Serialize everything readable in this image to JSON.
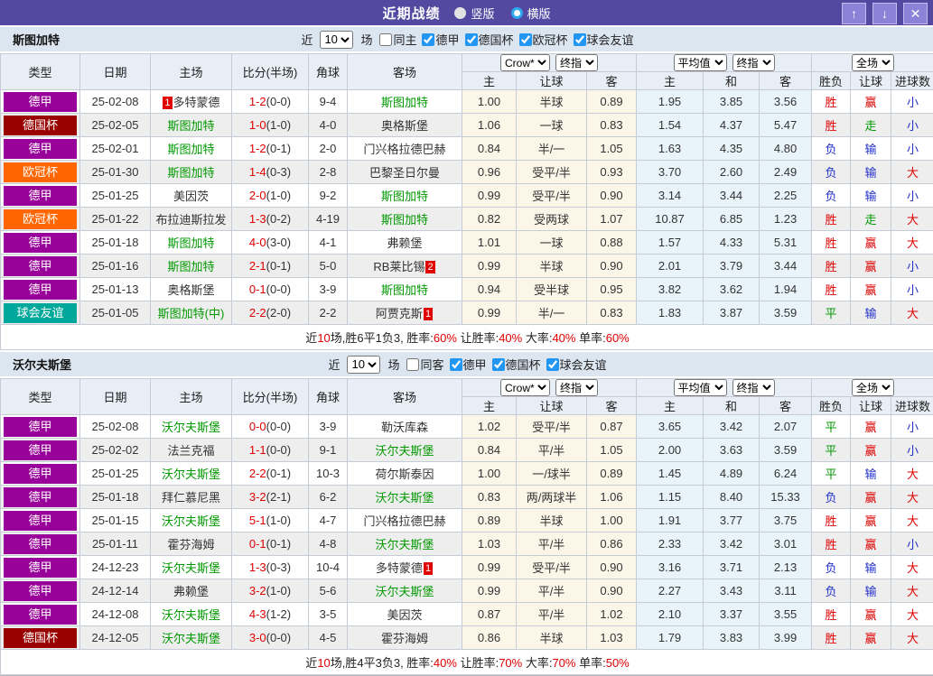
{
  "titlebar": {
    "title": "近期战绩",
    "radio_vertical": "竖版",
    "radio_horizontal": "横版",
    "btn_up": "↑",
    "btn_down": "↓",
    "btn_close": "✕"
  },
  "table": {
    "main_columns": [
      "类型",
      "日期",
      "主场",
      "比分(半场)",
      "角球",
      "客场"
    ],
    "sub_columns": [
      "主",
      "让球",
      "客",
      "主",
      "和",
      "客",
      "胜负",
      "让球",
      "进球数"
    ],
    "selects": {
      "bookmaker": "Crow*",
      "crow_stage": "终指",
      "average": "平均值",
      "avg_stage": "终指",
      "scope": "全场"
    }
  },
  "league_colors": {
    "德甲": "#990099",
    "德国杯": "#990000",
    "欧冠杯": "#ff6600",
    "球会友谊": "#00a79b"
  },
  "result_colors": {
    "r": "#e00000",
    "b": "#2330cc",
    "g": "#009900"
  },
  "sections": [
    {
      "team": "斯图加特",
      "filter": {
        "near": "近",
        "count": "10",
        "games": "场",
        "same": "同主",
        "leagues": [
          "德甲",
          "德国杯",
          "欧冠杯",
          "球会友谊"
        ]
      },
      "rows": [
        {
          "lg": "德甲",
          "dt": "25-02-08",
          "hm": {
            "n": "多特蒙德",
            "g": 0,
            "rk": "1",
            "rp": "b"
          },
          "sc": "1-2",
          "hf": "(0-0)",
          "ck": "9-4",
          "aw": {
            "n": "斯图加特",
            "g": 1
          },
          "od": [
            "1.00",
            "半球",
            "0.89"
          ],
          "av": [
            "1.95",
            "3.85",
            "3.56"
          ],
          "rs": [
            [
              "胜",
              "r"
            ],
            [
              "赢",
              "r"
            ],
            [
              "小",
              "b"
            ]
          ]
        },
        {
          "lg": "德国杯",
          "dt": "25-02-05",
          "hm": {
            "n": "斯图加特",
            "g": 1
          },
          "sc": "1-0",
          "hf": "(1-0)",
          "ck": "4-0",
          "aw": {
            "n": "奥格斯堡",
            "g": 0
          },
          "od": [
            "1.06",
            "一球",
            "0.83"
          ],
          "av": [
            "1.54",
            "4.37",
            "5.47"
          ],
          "rs": [
            [
              "胜",
              "r"
            ],
            [
              "走",
              "g"
            ],
            [
              "小",
              "b"
            ]
          ]
        },
        {
          "lg": "德甲",
          "dt": "25-02-01",
          "hm": {
            "n": "斯图加特",
            "g": 1
          },
          "sc": "1-2",
          "hf": "(0-1)",
          "ck": "2-0",
          "aw": {
            "n": "门兴格拉德巴赫",
            "g": 0
          },
          "od": [
            "0.84",
            "半/一",
            "1.05"
          ],
          "av": [
            "1.63",
            "4.35",
            "4.80"
          ],
          "rs": [
            [
              "负",
              "b"
            ],
            [
              "输",
              "b"
            ],
            [
              "小",
              "b"
            ]
          ]
        },
        {
          "lg": "欧冠杯",
          "dt": "25-01-30",
          "hm": {
            "n": "斯图加特",
            "g": 1
          },
          "sc": "1-4",
          "hf": "(0-3)",
          "ck": "2-8",
          "aw": {
            "n": "巴黎圣日尔曼",
            "g": 0
          },
          "od": [
            "0.96",
            "受平/半",
            "0.93"
          ],
          "av": [
            "3.70",
            "2.60",
            "2.49"
          ],
          "rs": [
            [
              "负",
              "b"
            ],
            [
              "输",
              "b"
            ],
            [
              "大",
              "r"
            ]
          ]
        },
        {
          "lg": "德甲",
          "dt": "25-01-25",
          "hm": {
            "n": "美因茨",
            "g": 0
          },
          "sc": "2-0",
          "hf": "(1-0)",
          "ck": "9-2",
          "aw": {
            "n": "斯图加特",
            "g": 1
          },
          "od": [
            "0.99",
            "受平/半",
            "0.90"
          ],
          "av": [
            "3.14",
            "3.44",
            "2.25"
          ],
          "rs": [
            [
              "负",
              "b"
            ],
            [
              "输",
              "b"
            ],
            [
              "小",
              "b"
            ]
          ]
        },
        {
          "lg": "欧冠杯",
          "dt": "25-01-22",
          "hm": {
            "n": "布拉迪斯拉发",
            "g": 0
          },
          "sc": "1-3",
          "hf": "(0-2)",
          "ck": "4-19",
          "aw": {
            "n": "斯图加特",
            "g": 1
          },
          "od": [
            "0.82",
            "受两球",
            "1.07"
          ],
          "av": [
            "10.87",
            "6.85",
            "1.23"
          ],
          "rs": [
            [
              "胜",
              "r"
            ],
            [
              "走",
              "g"
            ],
            [
              "大",
              "r"
            ]
          ]
        },
        {
          "lg": "德甲",
          "dt": "25-01-18",
          "hm": {
            "n": "斯图加特",
            "g": 1
          },
          "sc": "4-0",
          "hf": "(3-0)",
          "ck": "4-1",
          "aw": {
            "n": "弗赖堡",
            "g": 0
          },
          "od": [
            "1.01",
            "一球",
            "0.88"
          ],
          "av": [
            "1.57",
            "4.33",
            "5.31"
          ],
          "rs": [
            [
              "胜",
              "r"
            ],
            [
              "赢",
              "r"
            ],
            [
              "大",
              "r"
            ]
          ]
        },
        {
          "lg": "德甲",
          "dt": "25-01-16",
          "hm": {
            "n": "斯图加特",
            "g": 1
          },
          "sc": "2-1",
          "hf": "(0-1)",
          "ck": "5-0",
          "aw": {
            "n": "RB莱比锡",
            "g": 0,
            "rk": "2",
            "rp": "a"
          },
          "od": [
            "0.99",
            "半球",
            "0.90"
          ],
          "av": [
            "2.01",
            "3.79",
            "3.44"
          ],
          "rs": [
            [
              "胜",
              "r"
            ],
            [
              "赢",
              "r"
            ],
            [
              "小",
              "b"
            ]
          ]
        },
        {
          "lg": "德甲",
          "dt": "25-01-13",
          "hm": {
            "n": "奥格斯堡",
            "g": 0
          },
          "sc": "0-1",
          "hf": "(0-0)",
          "ck": "3-9",
          "aw": {
            "n": "斯图加特",
            "g": 1
          },
          "od": [
            "0.94",
            "受半球",
            "0.95"
          ],
          "av": [
            "3.82",
            "3.62",
            "1.94"
          ],
          "rs": [
            [
              "胜",
              "r"
            ],
            [
              "赢",
              "r"
            ],
            [
              "小",
              "b"
            ]
          ]
        },
        {
          "lg": "球会友谊",
          "dt": "25-01-05",
          "hm": {
            "n": "斯图加特(中)",
            "g": 1
          },
          "sc": "2-2",
          "hf": "(2-0)",
          "ck": "2-2",
          "aw": {
            "n": "阿贾克斯",
            "g": 0,
            "rk": "1",
            "rp": "a"
          },
          "od": [
            "0.99",
            "半/一",
            "0.83"
          ],
          "av": [
            "1.83",
            "3.87",
            "3.59"
          ],
          "rs": [
            [
              "平",
              "g"
            ],
            [
              "输",
              "b"
            ],
            [
              "大",
              "r"
            ]
          ]
        }
      ],
      "summary": [
        [
          "近",
          0
        ],
        [
          "10",
          1
        ],
        [
          "场,胜6平1负3, 胜率:",
          0
        ],
        [
          "60%",
          1
        ],
        [
          " 让胜率:",
          0
        ],
        [
          "40%",
          1
        ],
        [
          " 大率:",
          0
        ],
        [
          "40%",
          1
        ],
        [
          " 单率:",
          0
        ],
        [
          "60%",
          1
        ]
      ]
    },
    {
      "team": "沃尔夫斯堡",
      "filter": {
        "near": "近",
        "count": "10",
        "games": "场",
        "same": "同客",
        "leagues": [
          "德甲",
          "德国杯",
          "球会友谊"
        ]
      },
      "rows": [
        {
          "lg": "德甲",
          "dt": "25-02-08",
          "hm": {
            "n": "沃尔夫斯堡",
            "g": 1
          },
          "sc": "0-0",
          "hf": "(0-0)",
          "ck": "3-9",
          "aw": {
            "n": "勒沃库森",
            "g": 0
          },
          "od": [
            "1.02",
            "受平/半",
            "0.87"
          ],
          "av": [
            "3.65",
            "3.42",
            "2.07"
          ],
          "rs": [
            [
              "平",
              "g"
            ],
            [
              "赢",
              "r"
            ],
            [
              "小",
              "b"
            ]
          ]
        },
        {
          "lg": "德甲",
          "dt": "25-02-02",
          "hm": {
            "n": "法兰克福",
            "g": 0
          },
          "sc": "1-1",
          "hf": "(0-0)",
          "ck": "9-1",
          "aw": {
            "n": "沃尔夫斯堡",
            "g": 1
          },
          "od": [
            "0.84",
            "平/半",
            "1.05"
          ],
          "av": [
            "2.00",
            "3.63",
            "3.59"
          ],
          "rs": [
            [
              "平",
              "g"
            ],
            [
              "赢",
              "r"
            ],
            [
              "小",
              "b"
            ]
          ]
        },
        {
          "lg": "德甲",
          "dt": "25-01-25",
          "hm": {
            "n": "沃尔夫斯堡",
            "g": 1
          },
          "sc": "2-2",
          "hf": "(0-1)",
          "ck": "10-3",
          "aw": {
            "n": "荷尔斯泰因",
            "g": 0
          },
          "od": [
            "1.00",
            "一/球半",
            "0.89"
          ],
          "av": [
            "1.45",
            "4.89",
            "6.24"
          ],
          "rs": [
            [
              "平",
              "g"
            ],
            [
              "输",
              "b"
            ],
            [
              "大",
              "r"
            ]
          ]
        },
        {
          "lg": "德甲",
          "dt": "25-01-18",
          "hm": {
            "n": "拜仁慕尼黑",
            "g": 0
          },
          "sc": "3-2",
          "hf": "(2-1)",
          "ck": "6-2",
          "aw": {
            "n": "沃尔夫斯堡",
            "g": 1
          },
          "od": [
            "0.83",
            "两/两球半",
            "1.06"
          ],
          "av": [
            "1.15",
            "8.40",
            "15.33"
          ],
          "rs": [
            [
              "负",
              "b"
            ],
            [
              "赢",
              "r"
            ],
            [
              "大",
              "r"
            ]
          ]
        },
        {
          "lg": "德甲",
          "dt": "25-01-15",
          "hm": {
            "n": "沃尔夫斯堡",
            "g": 1
          },
          "sc": "5-1",
          "hf": "(1-0)",
          "ck": "4-7",
          "aw": {
            "n": "门兴格拉德巴赫",
            "g": 0
          },
          "od": [
            "0.89",
            "半球",
            "1.00"
          ],
          "av": [
            "1.91",
            "3.77",
            "3.75"
          ],
          "rs": [
            [
              "胜",
              "r"
            ],
            [
              "赢",
              "r"
            ],
            [
              "大",
              "r"
            ]
          ]
        },
        {
          "lg": "德甲",
          "dt": "25-01-11",
          "hm": {
            "n": "霍芬海姆",
            "g": 0
          },
          "sc": "0-1",
          "hf": "(0-1)",
          "ck": "4-8",
          "aw": {
            "n": "沃尔夫斯堡",
            "g": 1
          },
          "od": [
            "1.03",
            "平/半",
            "0.86"
          ],
          "av": [
            "2.33",
            "3.42",
            "3.01"
          ],
          "rs": [
            [
              "胜",
              "r"
            ],
            [
              "赢",
              "r"
            ],
            [
              "小",
              "b"
            ]
          ]
        },
        {
          "lg": "德甲",
          "dt": "24-12-23",
          "hm": {
            "n": "沃尔夫斯堡",
            "g": 1
          },
          "sc": "1-3",
          "hf": "(0-3)",
          "ck": "10-4",
          "aw": {
            "n": "多特蒙德",
            "g": 0,
            "rk": "1",
            "rp": "a"
          },
          "od": [
            "0.99",
            "受平/半",
            "0.90"
          ],
          "av": [
            "3.16",
            "3.71",
            "2.13"
          ],
          "rs": [
            [
              "负",
              "b"
            ],
            [
              "输",
              "b"
            ],
            [
              "大",
              "r"
            ]
          ]
        },
        {
          "lg": "德甲",
          "dt": "24-12-14",
          "hm": {
            "n": "弗赖堡",
            "g": 0
          },
          "sc": "3-2",
          "hf": "(1-0)",
          "ck": "5-6",
          "aw": {
            "n": "沃尔夫斯堡",
            "g": 1
          },
          "od": [
            "0.99",
            "平/半",
            "0.90"
          ],
          "av": [
            "2.27",
            "3.43",
            "3.11"
          ],
          "rs": [
            [
              "负",
              "b"
            ],
            [
              "输",
              "b"
            ],
            [
              "大",
              "r"
            ]
          ]
        },
        {
          "lg": "德甲",
          "dt": "24-12-08",
          "hm": {
            "n": "沃尔夫斯堡",
            "g": 1
          },
          "sc": "4-3",
          "hf": "(1-2)",
          "ck": "3-5",
          "aw": {
            "n": "美因茨",
            "g": 0
          },
          "od": [
            "0.87",
            "平/半",
            "1.02"
          ],
          "av": [
            "2.10",
            "3.37",
            "3.55"
          ],
          "rs": [
            [
              "胜",
              "r"
            ],
            [
              "赢",
              "r"
            ],
            [
              "大",
              "r"
            ]
          ]
        },
        {
          "lg": "德国杯",
          "dt": "24-12-05",
          "hm": {
            "n": "沃尔夫斯堡",
            "g": 1
          },
          "sc": "3-0",
          "hf": "(0-0)",
          "ck": "4-5",
          "aw": {
            "n": "霍芬海姆",
            "g": 0
          },
          "od": [
            "0.86",
            "半球",
            "1.03"
          ],
          "av": [
            "1.79",
            "3.83",
            "3.99"
          ],
          "rs": [
            [
              "胜",
              "r"
            ],
            [
              "赢",
              "r"
            ],
            [
              "大",
              "r"
            ]
          ]
        }
      ],
      "summary": [
        [
          "近",
          0
        ],
        [
          "10",
          1
        ],
        [
          "场,胜4平3负3, 胜率:",
          0
        ],
        [
          "40%",
          1
        ],
        [
          " 让胜率:",
          0
        ],
        [
          "70%",
          1
        ],
        [
          " 大率:",
          0
        ],
        [
          "70%",
          1
        ],
        [
          " 单率:",
          0
        ],
        [
          "50%",
          1
        ]
      ]
    }
  ]
}
